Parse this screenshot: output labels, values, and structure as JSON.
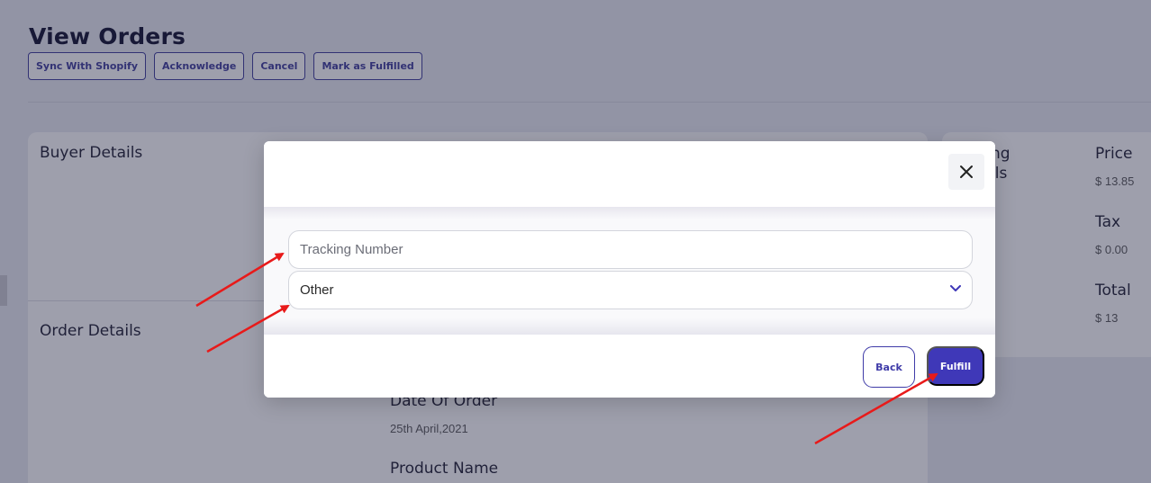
{
  "page": {
    "title": "View Orders"
  },
  "toolbar": {
    "sync_label": "Sync With Shopify",
    "acknowledge_label": "Acknowledge",
    "cancel_label": "Cancel",
    "fulfilled_label": "Mark as Fulfilled"
  },
  "sections": {
    "buyer_details": "Buyer Details",
    "order_details": "Order Details",
    "shipping_details_partial": "ng\nils"
  },
  "order": {
    "date_label": "Date Of Order",
    "date_value": "25th April,2021",
    "product_label": "Product Name"
  },
  "summary": {
    "price_label": "Price",
    "price_value": "$ 13.85",
    "tax_label": "Tax",
    "tax_value": "$ 0.00",
    "total_label": "Total",
    "total_value": "$ 13"
  },
  "modal": {
    "close_icon": "close-icon",
    "tracking_placeholder": "Tracking Number",
    "carrier_selected": "Other",
    "back_label": "Back",
    "fulfill_label": "Fulfill"
  },
  "colors": {
    "accent": "#3f38b8",
    "annotation_arrow": "#e81a1a"
  }
}
